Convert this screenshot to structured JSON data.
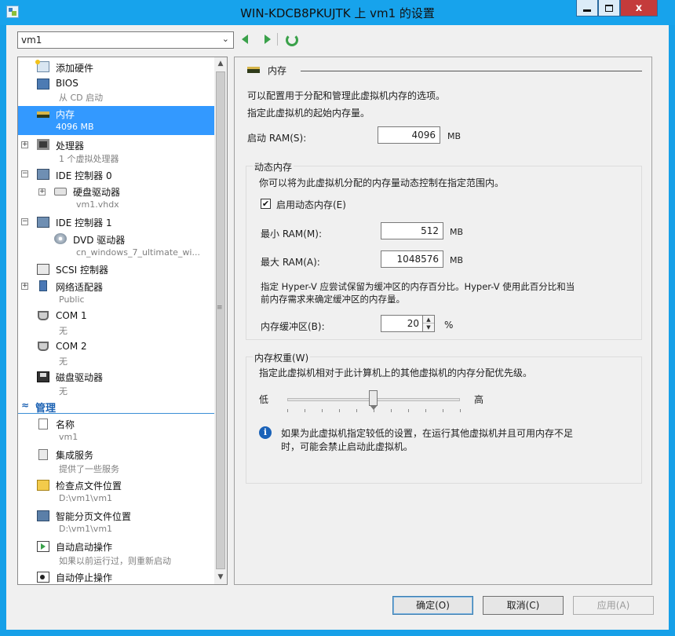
{
  "window": {
    "title": "WIN-KDCB8PKUJTK 上 vm1 的设置",
    "icon": "settings-icon",
    "close_glyph": "x"
  },
  "vm_selector": {
    "value": "vm1"
  },
  "tree": {
    "hardware_items": [
      {
        "label": "添加硬件",
        "sub": ""
      },
      {
        "label": "BIOS",
        "sub": "从 CD 启动"
      },
      {
        "label": "内存",
        "sub": "4096 MB"
      },
      {
        "label": "处理器",
        "sub": "1 个虚拟处理器"
      },
      {
        "label": "IDE 控制器 0",
        "sub": ""
      },
      {
        "label": "硬盘驱动器",
        "sub": "vm1.vhdx"
      },
      {
        "label": "IDE 控制器 1",
        "sub": ""
      },
      {
        "label": "DVD 驱动器",
        "sub": "cn_windows_7_ultimate_wi..."
      },
      {
        "label": "SCSI 控制器",
        "sub": ""
      },
      {
        "label": "网络适配器",
        "sub": "Public"
      },
      {
        "label": "COM 1",
        "sub": "无"
      },
      {
        "label": "COM 2",
        "sub": "无"
      },
      {
        "label": "磁盘驱动器",
        "sub": "无"
      }
    ],
    "management_header": "管理",
    "management_items": [
      {
        "label": "名称",
        "sub": "vm1"
      },
      {
        "label": "集成服务",
        "sub": "提供了一些服务"
      },
      {
        "label": "检查点文件位置",
        "sub": "D:\\vm1\\vm1"
      },
      {
        "label": "智能分页文件位置",
        "sub": "D:\\vm1\\vm1"
      },
      {
        "label": "自动启动操作",
        "sub": "如果以前运行过，则重新启动"
      },
      {
        "label": "自动停止操作",
        "sub": ""
      }
    ]
  },
  "memory_panel": {
    "section_title": "内存",
    "desc_line1": "可以配置用于分配和管理此虚拟机内存的选项。",
    "desc_line2": "指定此虚拟机的起始内存量。",
    "startup_ram_label": "启动 RAM(S):",
    "startup_ram_value": "4096",
    "unit_mb": "MB",
    "dynamic": {
      "title": "动态内存",
      "desc": "你可以将为此虚拟机分配的内存量动态控制在指定范围内。",
      "enable_label": "启用动态内存(E)",
      "enabled": true,
      "min_label": "最小 RAM(M):",
      "min_value": "512",
      "max_label": "最大 RAM(A):",
      "max_value": "1048576",
      "buffer_desc_line1": "指定 Hyper-V 应尝试保留为缓冲区的内存百分比。Hyper-V 使用此百分比和当",
      "buffer_desc_line2": "前内存需求来确定缓冲区的内存量。",
      "buffer_label": "内存缓冲区(B):",
      "buffer_value": "20",
      "percent": "%"
    },
    "weight": {
      "title": "内存权重(W)",
      "desc": "指定此虚拟机相对于此计算机上的其他虚拟机的内存分配优先级。",
      "low": "低",
      "high": "高",
      "slider_fraction": 0.5,
      "info_line1": "如果为此虚拟机指定较低的设置，在运行其他虚拟机并且可用内存不足",
      "info_line2": "时，可能会禁止启动此虚拟机。"
    }
  },
  "buttons": {
    "ok": "确定(O)",
    "cancel": "取消(C)",
    "apply": "应用(A)"
  }
}
